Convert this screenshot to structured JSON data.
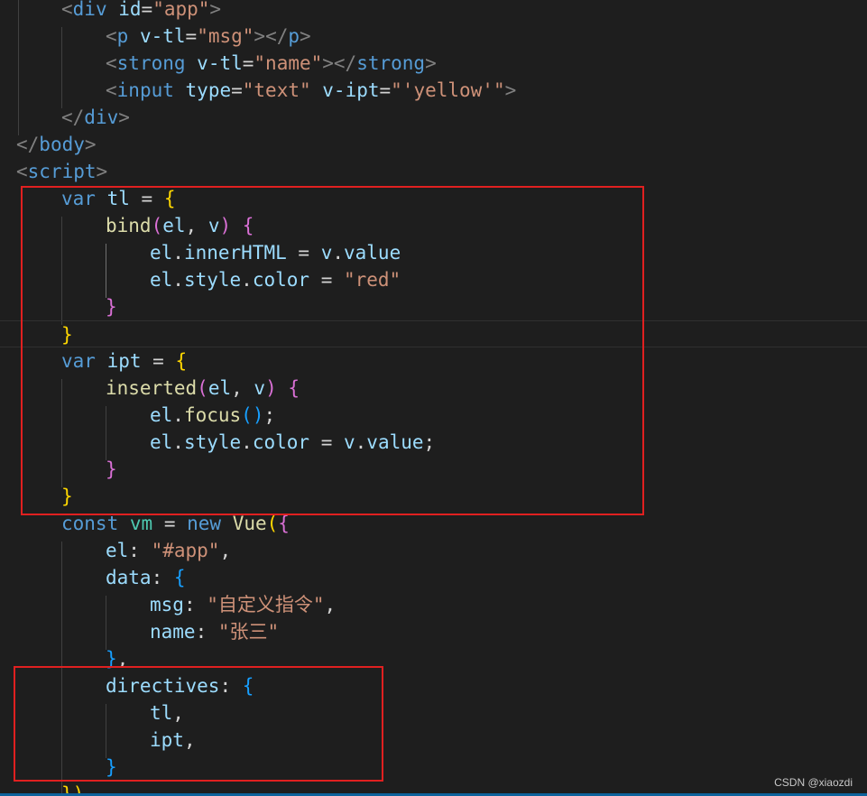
{
  "theme": {
    "background": "#1e1e1e",
    "highlight_color": "#e02020"
  },
  "code_lines": [
    [
      {
        "t": "<",
        "c": "tok-punc"
      },
      {
        "t": "div",
        "c": "tok-tag"
      },
      {
        "t": " ",
        "c": "tok-plain"
      },
      {
        "t": "id",
        "c": "tok-attr"
      },
      {
        "t": "=",
        "c": "tok-op"
      },
      {
        "t": "\"app\"",
        "c": "tok-str"
      },
      {
        "t": ">",
        "c": "tok-punc"
      }
    ],
    [
      {
        "t": "<",
        "c": "tok-punc"
      },
      {
        "t": "p",
        "c": "tok-tag"
      },
      {
        "t": " ",
        "c": "tok-plain"
      },
      {
        "t": "v-tl",
        "c": "tok-attr"
      },
      {
        "t": "=",
        "c": "tok-op"
      },
      {
        "t": "\"msg\"",
        "c": "tok-str"
      },
      {
        "t": "></",
        "c": "tok-punc"
      },
      {
        "t": "p",
        "c": "tok-tag"
      },
      {
        "t": ">",
        "c": "tok-punc"
      }
    ],
    [
      {
        "t": "<",
        "c": "tok-punc"
      },
      {
        "t": "strong",
        "c": "tok-tag"
      },
      {
        "t": " ",
        "c": "tok-plain"
      },
      {
        "t": "v-tl",
        "c": "tok-attr"
      },
      {
        "t": "=",
        "c": "tok-op"
      },
      {
        "t": "\"name\"",
        "c": "tok-str"
      },
      {
        "t": "></",
        "c": "tok-punc"
      },
      {
        "t": "strong",
        "c": "tok-tag"
      },
      {
        "t": ">",
        "c": "tok-punc"
      }
    ],
    [
      {
        "t": "<",
        "c": "tok-punc"
      },
      {
        "t": "input",
        "c": "tok-tag"
      },
      {
        "t": " ",
        "c": "tok-plain"
      },
      {
        "t": "type",
        "c": "tok-attr"
      },
      {
        "t": "=",
        "c": "tok-op"
      },
      {
        "t": "\"text\"",
        "c": "tok-str"
      },
      {
        "t": " ",
        "c": "tok-plain"
      },
      {
        "t": "v-ipt",
        "c": "tok-attr"
      },
      {
        "t": "=",
        "c": "tok-op"
      },
      {
        "t": "\"'yellow'\"",
        "c": "tok-str"
      },
      {
        "t": ">",
        "c": "tok-punc"
      }
    ],
    [
      {
        "t": "</",
        "c": "tok-punc"
      },
      {
        "t": "div",
        "c": "tok-tag"
      },
      {
        "t": ">",
        "c": "tok-punc"
      }
    ],
    [
      {
        "t": "</",
        "c": "tok-punc"
      },
      {
        "t": "body",
        "c": "tok-tag"
      },
      {
        "t": ">",
        "c": "tok-punc"
      }
    ],
    [
      {
        "t": "<",
        "c": "tok-punc"
      },
      {
        "t": "script",
        "c": "tok-tag"
      },
      {
        "t": ">",
        "c": "tok-punc"
      }
    ],
    [
      {
        "t": "var",
        "c": "tok-kw"
      },
      {
        "t": " ",
        "c": "tok-plain"
      },
      {
        "t": "tl",
        "c": "tok-var"
      },
      {
        "t": " = ",
        "c": "tok-op"
      },
      {
        "t": "{",
        "c": "tok-b1"
      }
    ],
    [
      {
        "t": "bind",
        "c": "tok-fn"
      },
      {
        "t": "(",
        "c": "tok-b2"
      },
      {
        "t": "el",
        "c": "tok-var"
      },
      {
        "t": ", ",
        "c": "tok-plain"
      },
      {
        "t": "v",
        "c": "tok-var"
      },
      {
        "t": ")",
        "c": "tok-b2"
      },
      {
        "t": " ",
        "c": "tok-plain"
      },
      {
        "t": "{",
        "c": "tok-b2"
      }
    ],
    [
      {
        "t": "el",
        "c": "tok-var"
      },
      {
        "t": ".",
        "c": "tok-plain"
      },
      {
        "t": "innerHTML",
        "c": "tok-var"
      },
      {
        "t": " = ",
        "c": "tok-op"
      },
      {
        "t": "v",
        "c": "tok-var"
      },
      {
        "t": ".",
        "c": "tok-plain"
      },
      {
        "t": "value",
        "c": "tok-var"
      }
    ],
    [
      {
        "t": "el",
        "c": "tok-var"
      },
      {
        "t": ".",
        "c": "tok-plain"
      },
      {
        "t": "style",
        "c": "tok-var"
      },
      {
        "t": ".",
        "c": "tok-plain"
      },
      {
        "t": "color",
        "c": "tok-var"
      },
      {
        "t": " = ",
        "c": "tok-op"
      },
      {
        "t": "\"red\"",
        "c": "tok-str"
      }
    ],
    [
      {
        "t": "}",
        "c": "tok-b2"
      }
    ],
    [
      {
        "t": "}",
        "c": "tok-b1"
      }
    ],
    [
      {
        "t": "var",
        "c": "tok-kw"
      },
      {
        "t": " ",
        "c": "tok-plain"
      },
      {
        "t": "ipt",
        "c": "tok-var"
      },
      {
        "t": " = ",
        "c": "tok-op"
      },
      {
        "t": "{",
        "c": "tok-b1"
      }
    ],
    [
      {
        "t": "inserted",
        "c": "tok-fn"
      },
      {
        "t": "(",
        "c": "tok-b2"
      },
      {
        "t": "el",
        "c": "tok-var"
      },
      {
        "t": ", ",
        "c": "tok-plain"
      },
      {
        "t": "v",
        "c": "tok-var"
      },
      {
        "t": ")",
        "c": "tok-b2"
      },
      {
        "t": " ",
        "c": "tok-plain"
      },
      {
        "t": "{",
        "c": "tok-b2"
      }
    ],
    [
      {
        "t": "el",
        "c": "tok-var"
      },
      {
        "t": ".",
        "c": "tok-plain"
      },
      {
        "t": "focus",
        "c": "tok-fn"
      },
      {
        "t": "()",
        "c": "tok-b3"
      },
      {
        "t": ";",
        "c": "tok-plain"
      }
    ],
    [
      {
        "t": "el",
        "c": "tok-var"
      },
      {
        "t": ".",
        "c": "tok-plain"
      },
      {
        "t": "style",
        "c": "tok-var"
      },
      {
        "t": ".",
        "c": "tok-plain"
      },
      {
        "t": "color",
        "c": "tok-var"
      },
      {
        "t": " = ",
        "c": "tok-op"
      },
      {
        "t": "v",
        "c": "tok-var"
      },
      {
        "t": ".",
        "c": "tok-plain"
      },
      {
        "t": "value",
        "c": "tok-var"
      },
      {
        "t": ";",
        "c": "tok-plain"
      }
    ],
    [
      {
        "t": "}",
        "c": "tok-b2"
      }
    ],
    [
      {
        "t": "}",
        "c": "tok-b1"
      }
    ],
    [
      {
        "t": "const",
        "c": "tok-kw"
      },
      {
        "t": " ",
        "c": "tok-plain"
      },
      {
        "t": "vm",
        "c": "tok-cls"
      },
      {
        "t": " = ",
        "c": "tok-op"
      },
      {
        "t": "new",
        "c": "tok-kw"
      },
      {
        "t": " ",
        "c": "tok-plain"
      },
      {
        "t": "Vue",
        "c": "tok-fn"
      },
      {
        "t": "(",
        "c": "tok-b1"
      },
      {
        "t": "{",
        "c": "tok-b2"
      }
    ],
    [
      {
        "t": "el",
        "c": "tok-var"
      },
      {
        "t": ": ",
        "c": "tok-plain"
      },
      {
        "t": "\"#app\"",
        "c": "tok-str"
      },
      {
        "t": ",",
        "c": "tok-plain"
      }
    ],
    [
      {
        "t": "data",
        "c": "tok-var"
      },
      {
        "t": ": ",
        "c": "tok-plain"
      },
      {
        "t": "{",
        "c": "tok-b3"
      }
    ],
    [
      {
        "t": "msg",
        "c": "tok-var"
      },
      {
        "t": ": ",
        "c": "tok-plain"
      },
      {
        "t": "\"自定义指令\"",
        "c": "tok-str"
      },
      {
        "t": ",",
        "c": "tok-plain"
      }
    ],
    [
      {
        "t": "name",
        "c": "tok-var"
      },
      {
        "t": ": ",
        "c": "tok-plain"
      },
      {
        "t": "\"张三\"",
        "c": "tok-str"
      }
    ],
    [
      {
        "t": "}",
        "c": "tok-b3"
      },
      {
        "t": ",",
        "c": "tok-plain"
      }
    ],
    [
      {
        "t": "directives",
        "c": "tok-var"
      },
      {
        "t": ": ",
        "c": "tok-plain"
      },
      {
        "t": "{",
        "c": "tok-b3"
      }
    ],
    [
      {
        "t": "tl",
        "c": "tok-var"
      },
      {
        "t": ",",
        "c": "tok-plain"
      }
    ],
    [
      {
        "t": "ipt",
        "c": "tok-var"
      },
      {
        "t": ",",
        "c": "tok-plain"
      }
    ],
    [
      {
        "t": "}",
        "c": "tok-b3"
      }
    ],
    [
      {
        "t": "})",
        "c": "tok-b1"
      }
    ]
  ],
  "watermark": "CSDN @xiaozdi"
}
